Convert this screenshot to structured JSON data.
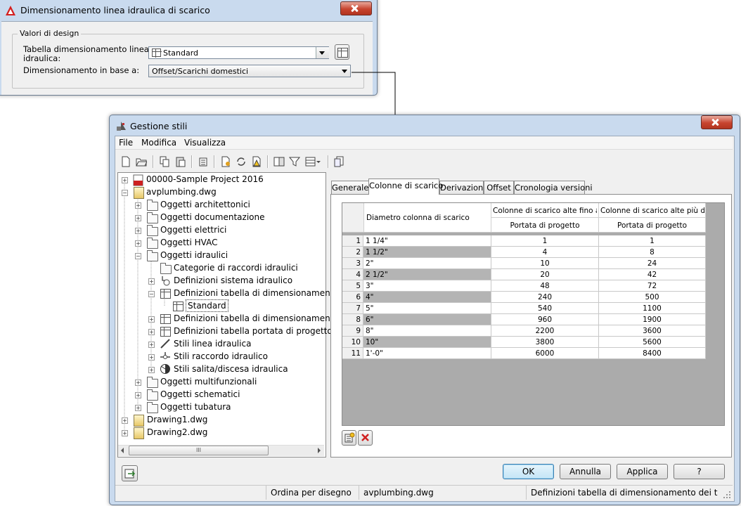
{
  "dialog1": {
    "title": "Dimensionamento linea idraulica di scarico",
    "group_label": "Valori di design",
    "row1_label_line1": "Tabella dimensionamento linea",
    "row1_label_line2": "idraulica:",
    "row1_value": "Standard",
    "row2_label": "Dimensionamento in base a:",
    "row2_value": "Offset/Scarichi domestici"
  },
  "dialog2": {
    "title": "Gestione stili",
    "menu": [
      "File",
      "Modifica",
      "Visualizza"
    ],
    "tree": [
      {
        "label": "00000-Sample Project 2016"
      },
      {
        "label": "avplumbing.dwg"
      },
      {
        "label": "Oggetti architettonici"
      },
      {
        "label": "Oggetti documentazione"
      },
      {
        "label": "Oggetti elettrici"
      },
      {
        "label": "Oggetti HVAC"
      },
      {
        "label": "Oggetti idraulici"
      },
      {
        "label": "Categorie di raccordi idraulici"
      },
      {
        "label": "Definizioni sistema idraulico"
      },
      {
        "label": "Definizioni tabella di dimensionamento"
      },
      {
        "label": "Standard"
      },
      {
        "label": "Definizioni tabella di dimensionamento"
      },
      {
        "label": "Definizioni tabella portata di progetto"
      },
      {
        "label": "Stili linea idraulica"
      },
      {
        "label": "Stili raccordo idraulico"
      },
      {
        "label": "Stili salita/discesa idraulica"
      },
      {
        "label": "Oggetti multifunzionali"
      },
      {
        "label": "Oggetti schematici"
      },
      {
        "label": "Oggetti tubatura"
      },
      {
        "label": "Drawing1.dwg"
      },
      {
        "label": "Drawing2.dwg"
      }
    ],
    "scroll_grip": "III",
    "tabs": [
      "Generale",
      "Colonne di scarico",
      "Derivazioni",
      "Offset",
      "Cronologia versioni"
    ],
    "table": {
      "col1_header": "Diametro colonna di scarico",
      "col2_header": "Colonne di scarico alte fino a...",
      "col3_header": "Colonne di scarico alte più di ...",
      "col2_sub": "Portata di progetto",
      "col3_sub": "Portata di progetto",
      "rows": [
        {
          "n": "1",
          "d": "1 1/4\"",
          "a": "1",
          "b": "1"
        },
        {
          "n": "2",
          "d": "1 1/2\"",
          "a": "4",
          "b": "8"
        },
        {
          "n": "3",
          "d": "2\"",
          "a": "10",
          "b": "24"
        },
        {
          "n": "4",
          "d": "2 1/2\"",
          "a": "20",
          "b": "42"
        },
        {
          "n": "5",
          "d": "3\"",
          "a": "48",
          "b": "72"
        },
        {
          "n": "6",
          "d": "4\"",
          "a": "240",
          "b": "500"
        },
        {
          "n": "7",
          "d": "5\"",
          "a": "540",
          "b": "1100"
        },
        {
          "n": "8",
          "d": "6\"",
          "a": "960",
          "b": "1900"
        },
        {
          "n": "9",
          "d": "8\"",
          "a": "2200",
          "b": "3600"
        },
        {
          "n": "10",
          "d": "10\"",
          "a": "3800",
          "b": "5600"
        },
        {
          "n": "11",
          "d": "1'-0\"",
          "a": "6000",
          "b": "8400"
        }
      ]
    },
    "buttons": {
      "ok": "OK",
      "cancel": "Annulla",
      "apply": "Applica",
      "help": "?"
    },
    "status": {
      "sort": "Ordina per disegno",
      "file": "avplumbing.dwg",
      "path": "Definizioni tabella di dimensionamento dei t  Standard"
    }
  },
  "colors": {
    "accent": "#c8dcf0",
    "title_bg": "#c9daee",
    "selected_row": "#b4b4b4",
    "delete_red": "#d02020"
  }
}
